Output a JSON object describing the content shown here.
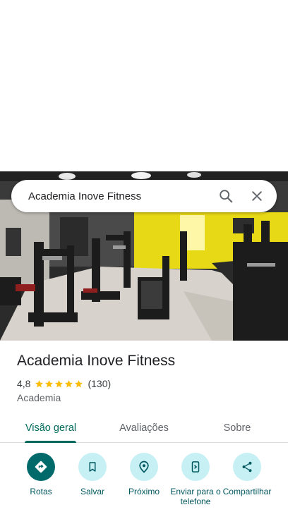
{
  "search": {
    "query": "Academia Inove Fitness"
  },
  "place": {
    "name": "Academia Inove Fitness",
    "rating": "4,8",
    "rating_stars": 5,
    "reviews_count": "(130)",
    "category": "Academia"
  },
  "tabs": [
    {
      "label": "Visão geral",
      "active": true
    },
    {
      "label": "Avaliações",
      "active": false
    },
    {
      "label": "Sobre",
      "active": false
    }
  ],
  "actions": [
    {
      "label": "Rotas",
      "icon": "directions-icon"
    },
    {
      "label": "Salvar",
      "icon": "bookmark-icon"
    },
    {
      "label": "Próximo",
      "icon": "nearby-icon"
    },
    {
      "label": "Enviar para o telefone",
      "icon": "send-to-phone-icon"
    },
    {
      "label": "Compartilhar",
      "icon": "share-icon"
    }
  ],
  "colors": {
    "accent": "#00695c",
    "action_circle": "#c7f0f5",
    "primary_circle": "#006a6a",
    "star": "#fbbc04",
    "wall_yellow": "#e8d916"
  }
}
